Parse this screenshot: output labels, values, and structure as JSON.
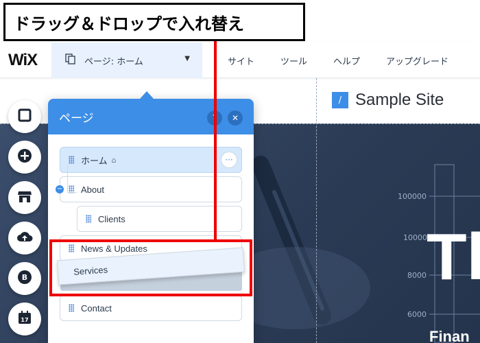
{
  "annotation": {
    "title": "ドラッグ＆ドロップで入れ替え"
  },
  "topbar": {
    "logo": "WiX",
    "page_selector": "ページ: ホーム",
    "menu": [
      "サイト",
      "ツール",
      "ヘルプ",
      "アップグレード"
    ]
  },
  "site": {
    "logo_glyph": "/",
    "name": "Sample Site",
    "chart_ticks": [
      "100000",
      "10000",
      "8000",
      "6000"
    ],
    "hero_text": "Th",
    "hero_subtext": "Finan"
  },
  "panel": {
    "title": "ページ",
    "help": "?",
    "close": "✕",
    "pages": [
      {
        "label": "ホーム",
        "selected": true,
        "more": "···"
      },
      {
        "label": "About"
      },
      {
        "label": "Clients"
      },
      {
        "label": "News & Updates"
      },
      {
        "label": "Contact"
      }
    ],
    "dragging": "Services"
  },
  "colors": {
    "accent": "#3d8ee6",
    "annotation": "#e00000"
  }
}
